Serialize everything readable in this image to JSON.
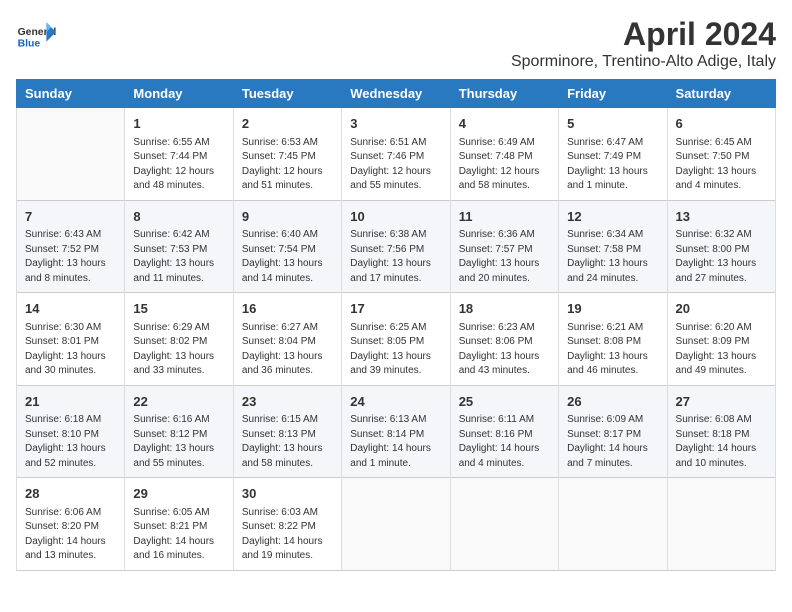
{
  "header": {
    "logo_general": "General",
    "logo_blue": "Blue",
    "month_year": "April 2024",
    "location": "Sporminore, Trentino-Alto Adige, Italy"
  },
  "columns": [
    "Sunday",
    "Monday",
    "Tuesday",
    "Wednesday",
    "Thursday",
    "Friday",
    "Saturday"
  ],
  "rows": [
    [
      {
        "num": "",
        "content": ""
      },
      {
        "num": "1",
        "content": "Sunrise: 6:55 AM\nSunset: 7:44 PM\nDaylight: 12 hours\nand 48 minutes."
      },
      {
        "num": "2",
        "content": "Sunrise: 6:53 AM\nSunset: 7:45 PM\nDaylight: 12 hours\nand 51 minutes."
      },
      {
        "num": "3",
        "content": "Sunrise: 6:51 AM\nSunset: 7:46 PM\nDaylight: 12 hours\nand 55 minutes."
      },
      {
        "num": "4",
        "content": "Sunrise: 6:49 AM\nSunset: 7:48 PM\nDaylight: 12 hours\nand 58 minutes."
      },
      {
        "num": "5",
        "content": "Sunrise: 6:47 AM\nSunset: 7:49 PM\nDaylight: 13 hours\nand 1 minute."
      },
      {
        "num": "6",
        "content": "Sunrise: 6:45 AM\nSunset: 7:50 PM\nDaylight: 13 hours\nand 4 minutes."
      }
    ],
    [
      {
        "num": "7",
        "content": "Sunrise: 6:43 AM\nSunset: 7:52 PM\nDaylight: 13 hours\nand 8 minutes."
      },
      {
        "num": "8",
        "content": "Sunrise: 6:42 AM\nSunset: 7:53 PM\nDaylight: 13 hours\nand 11 minutes."
      },
      {
        "num": "9",
        "content": "Sunrise: 6:40 AM\nSunset: 7:54 PM\nDaylight: 13 hours\nand 14 minutes."
      },
      {
        "num": "10",
        "content": "Sunrise: 6:38 AM\nSunset: 7:56 PM\nDaylight: 13 hours\nand 17 minutes."
      },
      {
        "num": "11",
        "content": "Sunrise: 6:36 AM\nSunset: 7:57 PM\nDaylight: 13 hours\nand 20 minutes."
      },
      {
        "num": "12",
        "content": "Sunrise: 6:34 AM\nSunset: 7:58 PM\nDaylight: 13 hours\nand 24 minutes."
      },
      {
        "num": "13",
        "content": "Sunrise: 6:32 AM\nSunset: 8:00 PM\nDaylight: 13 hours\nand 27 minutes."
      }
    ],
    [
      {
        "num": "14",
        "content": "Sunrise: 6:30 AM\nSunset: 8:01 PM\nDaylight: 13 hours\nand 30 minutes."
      },
      {
        "num": "15",
        "content": "Sunrise: 6:29 AM\nSunset: 8:02 PM\nDaylight: 13 hours\nand 33 minutes."
      },
      {
        "num": "16",
        "content": "Sunrise: 6:27 AM\nSunset: 8:04 PM\nDaylight: 13 hours\nand 36 minutes."
      },
      {
        "num": "17",
        "content": "Sunrise: 6:25 AM\nSunset: 8:05 PM\nDaylight: 13 hours\nand 39 minutes."
      },
      {
        "num": "18",
        "content": "Sunrise: 6:23 AM\nSunset: 8:06 PM\nDaylight: 13 hours\nand 43 minutes."
      },
      {
        "num": "19",
        "content": "Sunrise: 6:21 AM\nSunset: 8:08 PM\nDaylight: 13 hours\nand 46 minutes."
      },
      {
        "num": "20",
        "content": "Sunrise: 6:20 AM\nSunset: 8:09 PM\nDaylight: 13 hours\nand 49 minutes."
      }
    ],
    [
      {
        "num": "21",
        "content": "Sunrise: 6:18 AM\nSunset: 8:10 PM\nDaylight: 13 hours\nand 52 minutes."
      },
      {
        "num": "22",
        "content": "Sunrise: 6:16 AM\nSunset: 8:12 PM\nDaylight: 13 hours\nand 55 minutes."
      },
      {
        "num": "23",
        "content": "Sunrise: 6:15 AM\nSunset: 8:13 PM\nDaylight: 13 hours\nand 58 minutes."
      },
      {
        "num": "24",
        "content": "Sunrise: 6:13 AM\nSunset: 8:14 PM\nDaylight: 14 hours\nand 1 minute."
      },
      {
        "num": "25",
        "content": "Sunrise: 6:11 AM\nSunset: 8:16 PM\nDaylight: 14 hours\nand 4 minutes."
      },
      {
        "num": "26",
        "content": "Sunrise: 6:09 AM\nSunset: 8:17 PM\nDaylight: 14 hours\nand 7 minutes."
      },
      {
        "num": "27",
        "content": "Sunrise: 6:08 AM\nSunset: 8:18 PM\nDaylight: 14 hours\nand 10 minutes."
      }
    ],
    [
      {
        "num": "28",
        "content": "Sunrise: 6:06 AM\nSunset: 8:20 PM\nDaylight: 14 hours\nand 13 minutes."
      },
      {
        "num": "29",
        "content": "Sunrise: 6:05 AM\nSunset: 8:21 PM\nDaylight: 14 hours\nand 16 minutes."
      },
      {
        "num": "30",
        "content": "Sunrise: 6:03 AM\nSunset: 8:22 PM\nDaylight: 14 hours\nand 19 minutes."
      },
      {
        "num": "",
        "content": ""
      },
      {
        "num": "",
        "content": ""
      },
      {
        "num": "",
        "content": ""
      },
      {
        "num": "",
        "content": ""
      }
    ]
  ]
}
